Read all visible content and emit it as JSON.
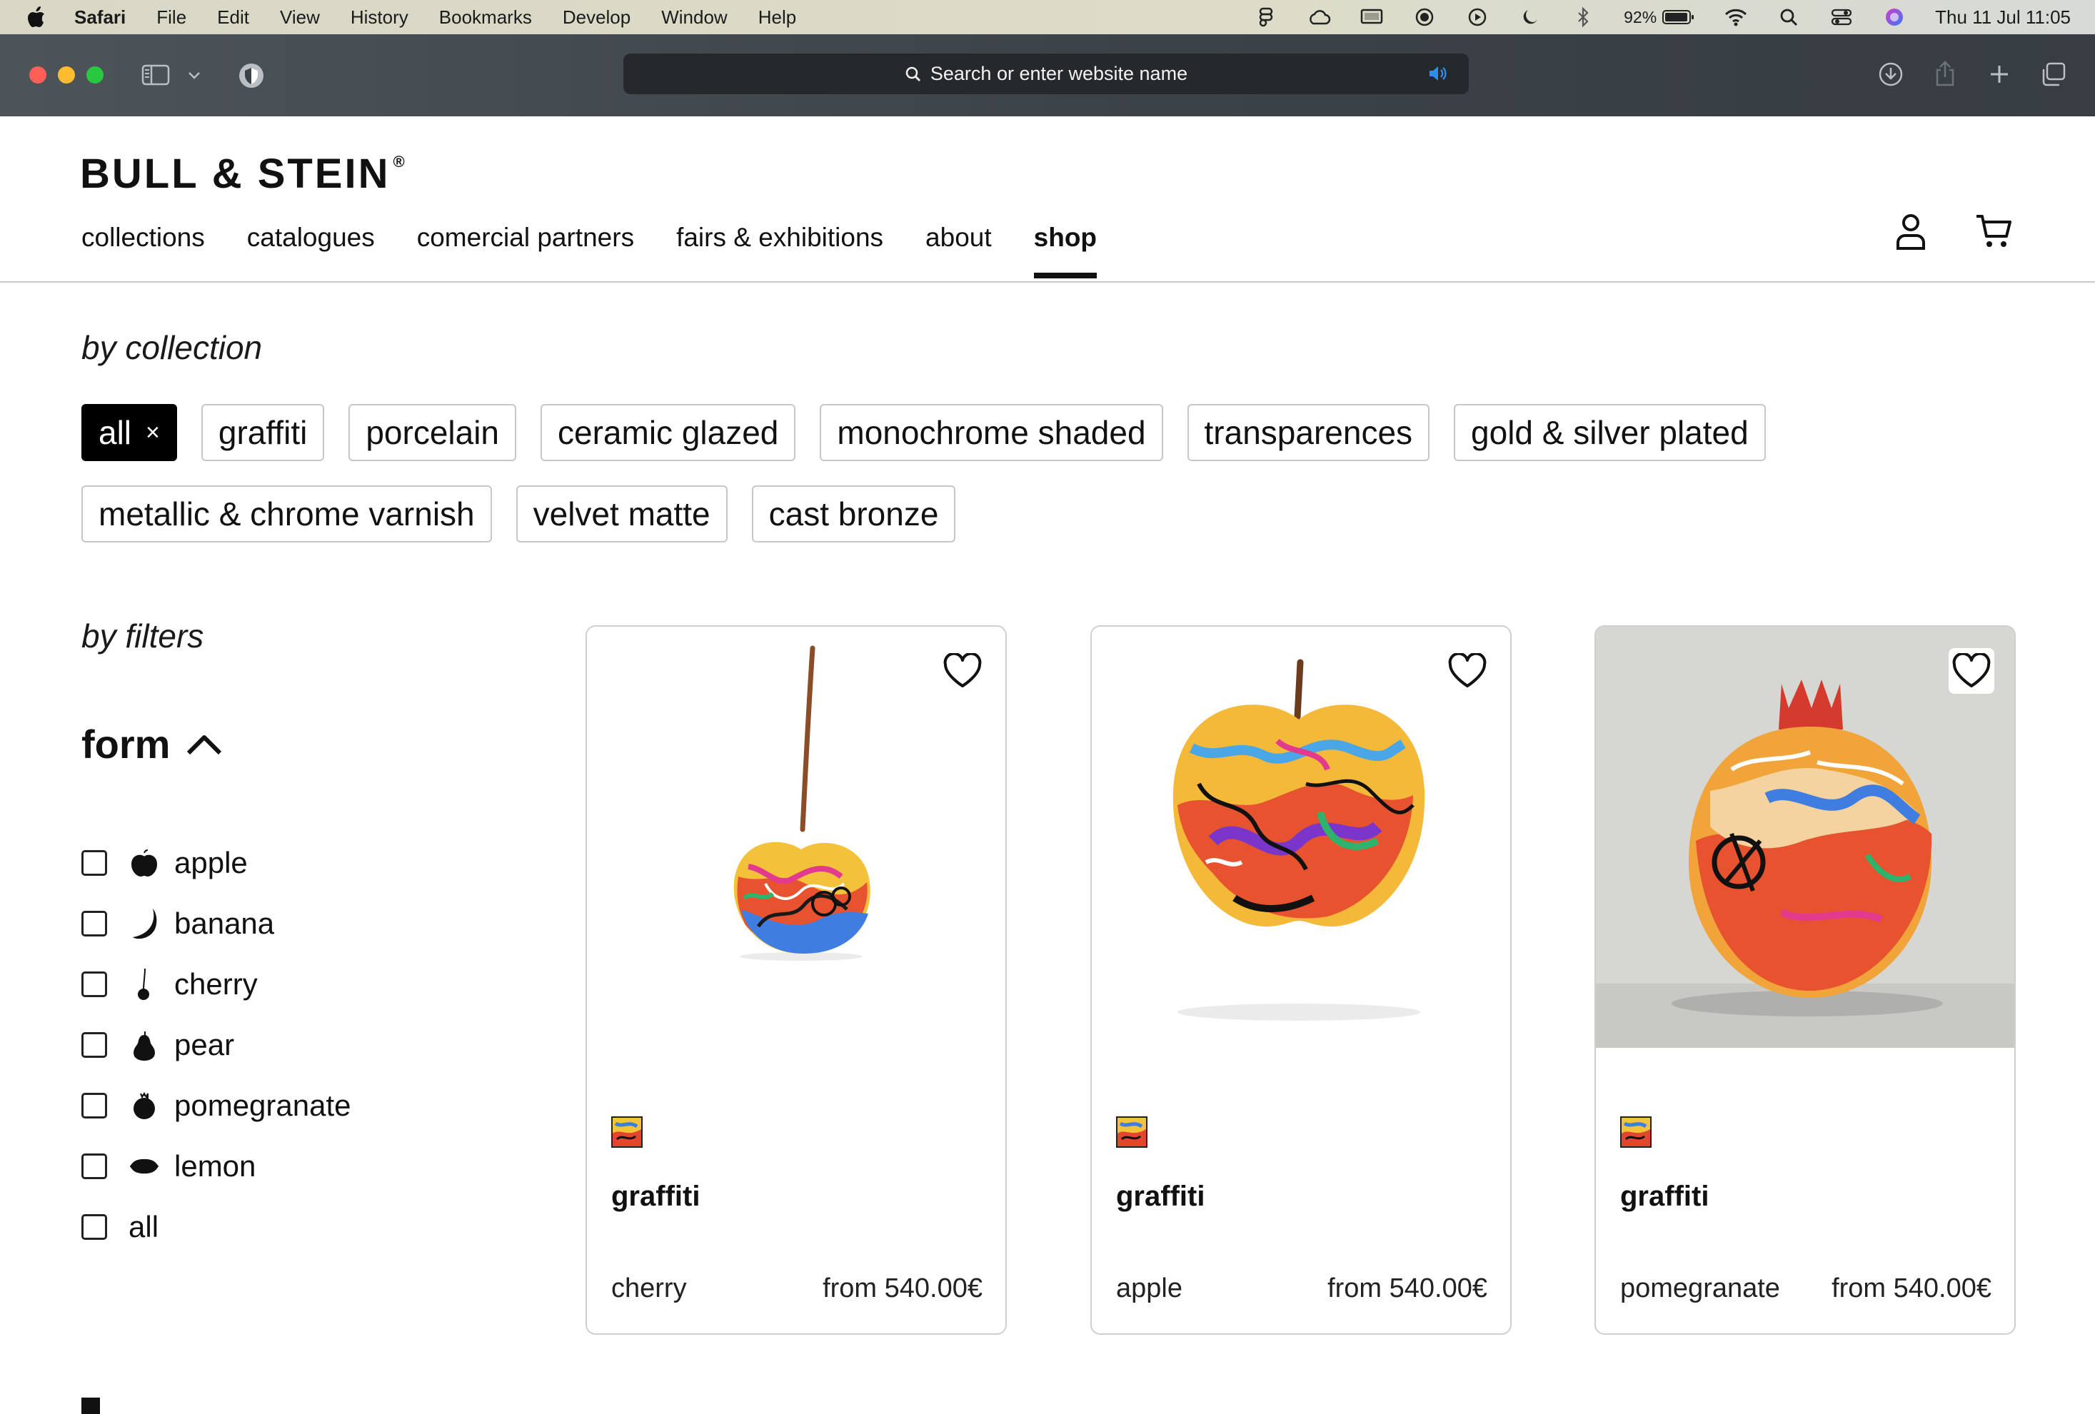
{
  "menubar": {
    "app_name": "Safari",
    "items": [
      "File",
      "Edit",
      "View",
      "History",
      "Bookmarks",
      "Develop",
      "Window",
      "Help"
    ],
    "battery": "92%",
    "clock": "Thu 11 Jul  11:05"
  },
  "browser": {
    "address_placeholder": "Search or enter website name"
  },
  "site": {
    "logo": "BULL & STEIN",
    "logo_mark": "®",
    "nav": [
      "collections",
      "catalogues",
      "comercial partners",
      "fairs & exhibitions",
      "about",
      "shop"
    ],
    "active_nav": "shop"
  },
  "collections": {
    "heading": "by collection",
    "chips": [
      "all",
      "graffiti",
      "porcelain",
      "ceramic glazed",
      "monochrome shaded",
      "transparences",
      "gold & silver plated",
      "metallic & chrome varnish",
      "velvet matte",
      "cast bronze"
    ],
    "close_glyph": "×"
  },
  "filters": {
    "heading": "by filters",
    "form_heading": "form",
    "options": [
      "apple",
      "banana",
      "cherry",
      "pear",
      "pomegranate",
      "lemon",
      "all"
    ]
  },
  "products": [
    {
      "collection": "graffiti",
      "form": "cherry",
      "price": "from 540.00€"
    },
    {
      "collection": "graffiti",
      "form": "apple",
      "price": "from 540.00€"
    },
    {
      "collection": "graffiti",
      "form": "pomegranate",
      "price": "from 540.00€"
    }
  ],
  "colors": {
    "accent": "#000000",
    "chip_border": "#c7c7c7",
    "toolbar": "#3b4248"
  }
}
